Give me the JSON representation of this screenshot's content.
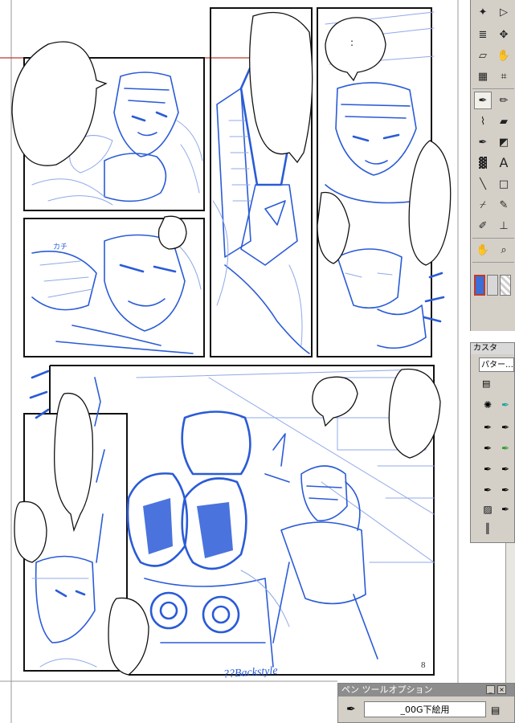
{
  "canvas": {
    "page_number": "8",
    "balloon_text": ":",
    "sketch_note": "??Backstyle",
    "guide_color": "#c0392b",
    "ink_color": "#2a5bd7"
  },
  "toolbox": {
    "tools": [
      {
        "name": "magic-wand-icon",
        "glyph": "✦"
      },
      {
        "name": "select-arrow-icon",
        "glyph": "▷"
      },
      {
        "name": "layer-stack-icon",
        "glyph": "≣"
      },
      {
        "name": "move-icon",
        "glyph": "✥"
      },
      {
        "name": "transform-icon",
        "glyph": "▱"
      },
      {
        "name": "hand-grab-icon",
        "glyph": "✋"
      },
      {
        "name": "grid-icon",
        "glyph": "▦"
      },
      {
        "name": "crop-icon",
        "glyph": "⌗"
      },
      {
        "name": "pen-icon",
        "glyph": "✒"
      },
      {
        "name": "pencil-icon",
        "glyph": "✏"
      },
      {
        "name": "brush-icon",
        "glyph": "🖌"
      },
      {
        "name": "eraser-icon",
        "glyph": "▰"
      },
      {
        "name": "fill-pen-icon",
        "glyph": "✒"
      },
      {
        "name": "bucket-icon",
        "glyph": "◩"
      },
      {
        "name": "gradient-icon",
        "glyph": "▓"
      },
      {
        "name": "text-icon",
        "glyph": "A"
      },
      {
        "name": "line-icon",
        "glyph": "╲"
      },
      {
        "name": "rectangle-icon",
        "glyph": "□"
      },
      {
        "name": "eyedropper-icon",
        "glyph": "⌿"
      },
      {
        "name": "tone-pen-icon",
        "glyph": "✎"
      },
      {
        "name": "ruler-pen-icon",
        "glyph": "✐"
      },
      {
        "name": "stamp-icon",
        "glyph": "⊥"
      },
      {
        "name": "hand-icon",
        "glyph": "✋"
      },
      {
        "name": "zoom-icon",
        "glyph": "🔍"
      }
    ],
    "fg_color": "#3a6fd8",
    "bg_color": "#d8d8d8"
  },
  "custom_panel": {
    "title": "カスタ",
    "dropdown": "パター…"
  },
  "pen_options": {
    "title": "ペン ツールオプション",
    "preset": "_00G下絵用"
  }
}
